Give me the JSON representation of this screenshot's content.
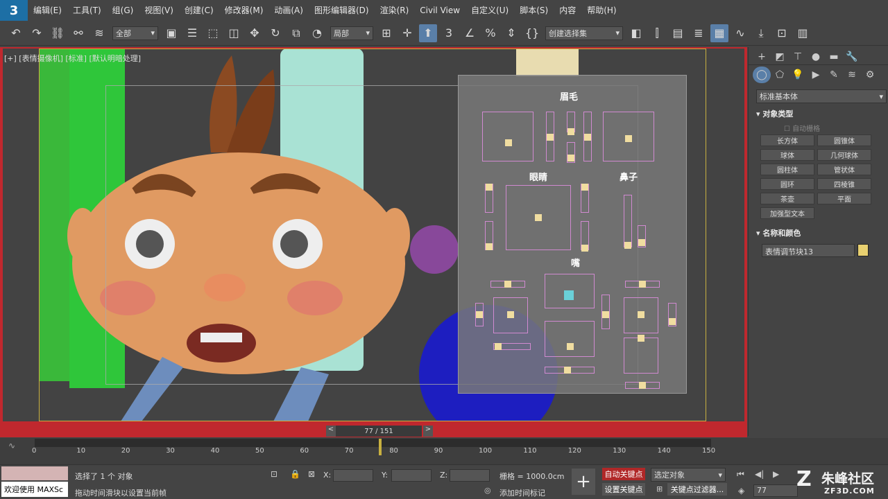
{
  "menu": [
    "编辑(E)",
    "工具(T)",
    "组(G)",
    "视图(V)",
    "创建(C)",
    "修改器(M)",
    "动画(A)",
    "图形编辑器(D)",
    "渲染(R)",
    "Civil View",
    "自定义(U)",
    "脚本(S)",
    "内容",
    "帮助(H)"
  ],
  "toolbar": {
    "filter_value": "全部",
    "refcoord_value": "局部",
    "selection_set_value": "创建选择集",
    "undo_icon": "undo-icon",
    "redo_icon": "redo-icon"
  },
  "viewport": {
    "label": "[+] [表情摄像机] [标准] [默认明暗处理]"
  },
  "control_panel": {
    "eyebrow_label": "眉毛",
    "eye_label": "眼睛",
    "nose_label": "鼻子",
    "mouth_label": "嘴"
  },
  "command_panel": {
    "category_value": "标准基本体",
    "object_type_title": "对象类型",
    "autogrid_label": "自动栅格",
    "buttons": [
      "长方体",
      "圆锥体",
      "球体",
      "几何球体",
      "圆柱体",
      "管状体",
      "圆环",
      "四棱锥",
      "茶壶",
      "平面",
      "加强型文本"
    ],
    "name_color_title": "名称和颜色",
    "object_name": "表情调节块13",
    "object_color": "#e8d070"
  },
  "timeline": {
    "slider_text": "77 / 151",
    "prev_label": "<",
    "next_label": ">",
    "ticks": [
      "0",
      "10",
      "20",
      "30",
      "40",
      "50",
      "60",
      "70",
      "80",
      "90",
      "100",
      "110",
      "120",
      "130",
      "140",
      "150"
    ]
  },
  "status": {
    "welcome_text": "欢迎使用 MAXSc",
    "selection_text": "选择了 1 个 对象",
    "hint_text": "拖动时间滑块以设置当前帧",
    "x_label": "X:",
    "y_label": "Y:",
    "z_label": "Z:",
    "grid_text": "栅格 = 1000.0cm",
    "add_time_tag": "添加时间标记",
    "auto_key": "自动关键点",
    "set_key": "设置关键点",
    "selected_object": "选定对象",
    "key_filter": "关键点过滤器...",
    "current_frame": "77"
  },
  "watermark": "朱峰社区",
  "watermark_url": "ZF3D.COM"
}
